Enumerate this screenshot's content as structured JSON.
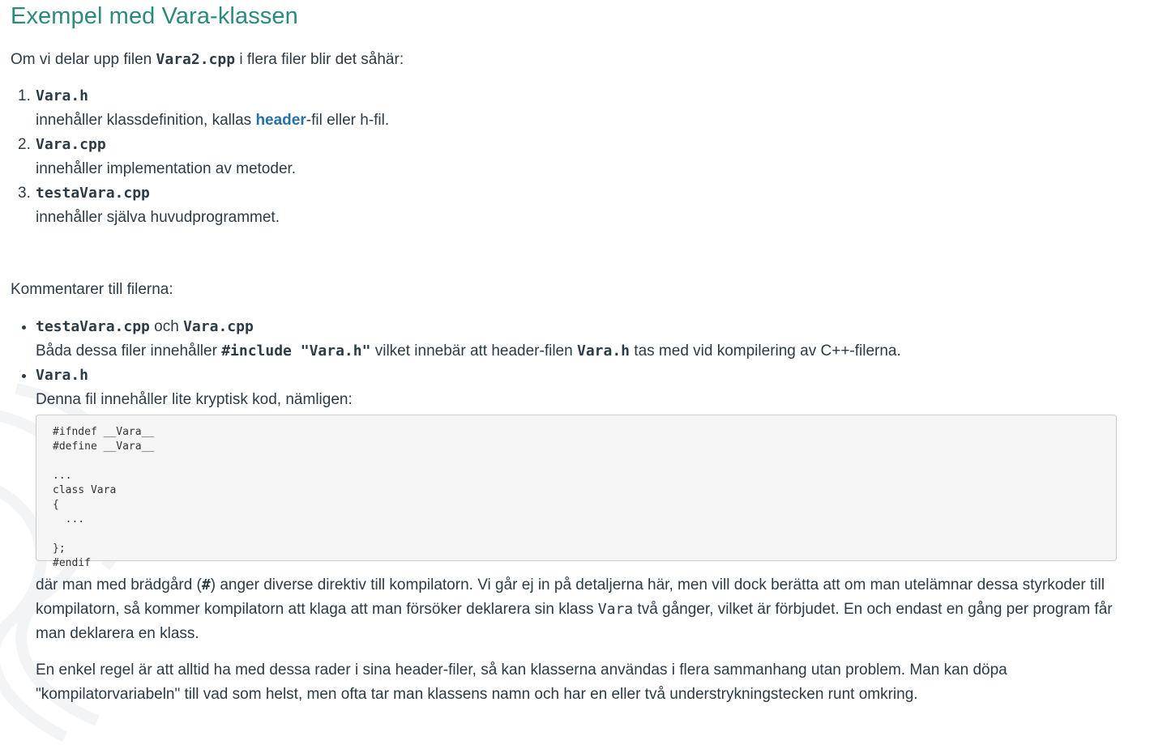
{
  "heading": "Exempel med Vara-klassen",
  "intro": {
    "before": "Om vi delar upp filen ",
    "code": "Vara2.cpp",
    "after": " i flera filer blir det såhär:"
  },
  "files": [
    {
      "marker": "1.",
      "name": "Vara.h",
      "desc_before": "innehåller klassdefinition, kallas ",
      "desc_link": "header",
      "desc_after": "-fil eller h-fil."
    },
    {
      "marker": "2.",
      "name": "Vara.cpp",
      "desc": "innehåller implementation av metoder."
    },
    {
      "marker": "3.",
      "name": "testaVara.cpp",
      "desc": "innehåller själva huvudprogrammet."
    }
  ],
  "comments_label": "Kommentarer till filerna:",
  "bullets": [
    {
      "code1": "testaVara.cpp",
      "mid": " och ",
      "code2": "Vara.cpp",
      "desc_before": "Båda dessa filer innehåller ",
      "desc_code": "#include \"Vara.h\"",
      "desc_mid": " vilket innebär att header-filen ",
      "desc_code2": "Vara.h",
      "desc_after": " tas med vid kompilering av C++-filerna."
    },
    {
      "code1": "Vara.h",
      "desc": "Denna fil innehåller lite kryptisk kod, nämligen:",
      "code_block": "#ifndef __Vara__\n#define __Vara__\n\n...\nclass Vara\n{\n  ...\n\n};\n#endif",
      "para1_a": "där man med brädgård (",
      "para1_hash": "#",
      "para1_b": ") anger diverse direktiv till kompilatorn. Vi går ej in på detaljerna här, men vill dock berätta att om man utelämnar dessa styrkoder till kompilatorn, så kommer kompilatorn att klaga att man försöker deklarera sin klass ",
      "para1_code": "Vara",
      "para1_c": " två gånger, vilket är förbjudet. En och endast en gång per program får man deklarera en klass.",
      "para2": "En enkel regel är att alltid ha med dessa rader i sina header-filer, så kan klasserna användas i flera sammanhang utan problem. Man kan döpa \"kompilatorvariabeln\" till vad som helst, men ofta tar man klassens namn och har en eller två understrykningstecken runt omkring."
    }
  ],
  "colors": {
    "heading": "#2b8a7c",
    "text": "#2d3b45",
    "link": "#2471a8",
    "code_bg": "#f5f5f5",
    "code_border": "#cccccc"
  }
}
